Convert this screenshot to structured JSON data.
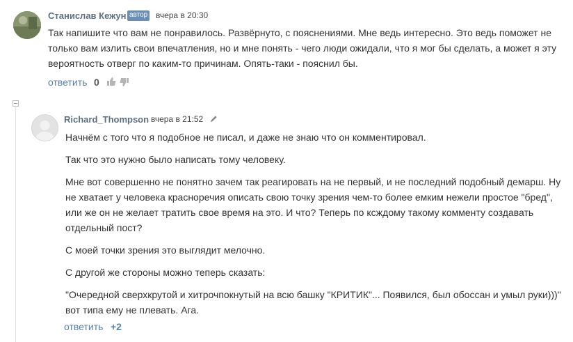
{
  "comment1": {
    "author": "Станислав Кежун",
    "badge": "автор",
    "time": "вчера в 20:30",
    "paragraphs": [
      "Так напишите что вам не понравилось. Развёрнуто, с пояснениями. Мне ведь интересно. Это ведь поможет не только вам излить свои впечатления, но и мне понять - чего люди ожидали, что я мог бы сделать, а может я эту вероятность отверг по каким-то причинам. Опять-таки - пояснил бы."
    ],
    "reply_label": "ответить",
    "score": "0"
  },
  "comment2": {
    "author": "Richard_Thompson",
    "time": "вчера в 21:52",
    "paragraphs": [
      "Начнём с того что я подобное не писал, и даже не знаю что он комментировал.",
      "Так что это нужно было написать тому человеку.",
      "Мне вот совершенно не понятно зачем так реагировать на не первый, и не последний подобный демарш. Ну не хватает у человека красноречия описать свою точку зрения чем-то более емким нежели простое \"бред\", или же он не желает тратить свое время на это. И что? Теперь по ксждому такому комменту создавать отдельный пост?",
      "С моей точки зрения это выглядит мелочно.",
      "С другой же стороны можно теперь сказать:",
      "\"Очередной сверхкрутой и хитрочпокнутый на всю башку \"КРИТИК\"... Появился, был обоссан и умыл руки)))\" вот типа ему не плевать. Ага."
    ],
    "reply_label": "ответить",
    "score": "+2"
  },
  "icons": {
    "edit": "pencil-icon",
    "upvote": "thumb-up-icon",
    "downvote": "thumb-down-icon",
    "collapse": "collapse-thread-icon"
  },
  "colors": {
    "author": "#5e6f80",
    "badge_bg": "#6b8fb4",
    "link": "#5981a8",
    "score_positive": "#5981a8"
  }
}
